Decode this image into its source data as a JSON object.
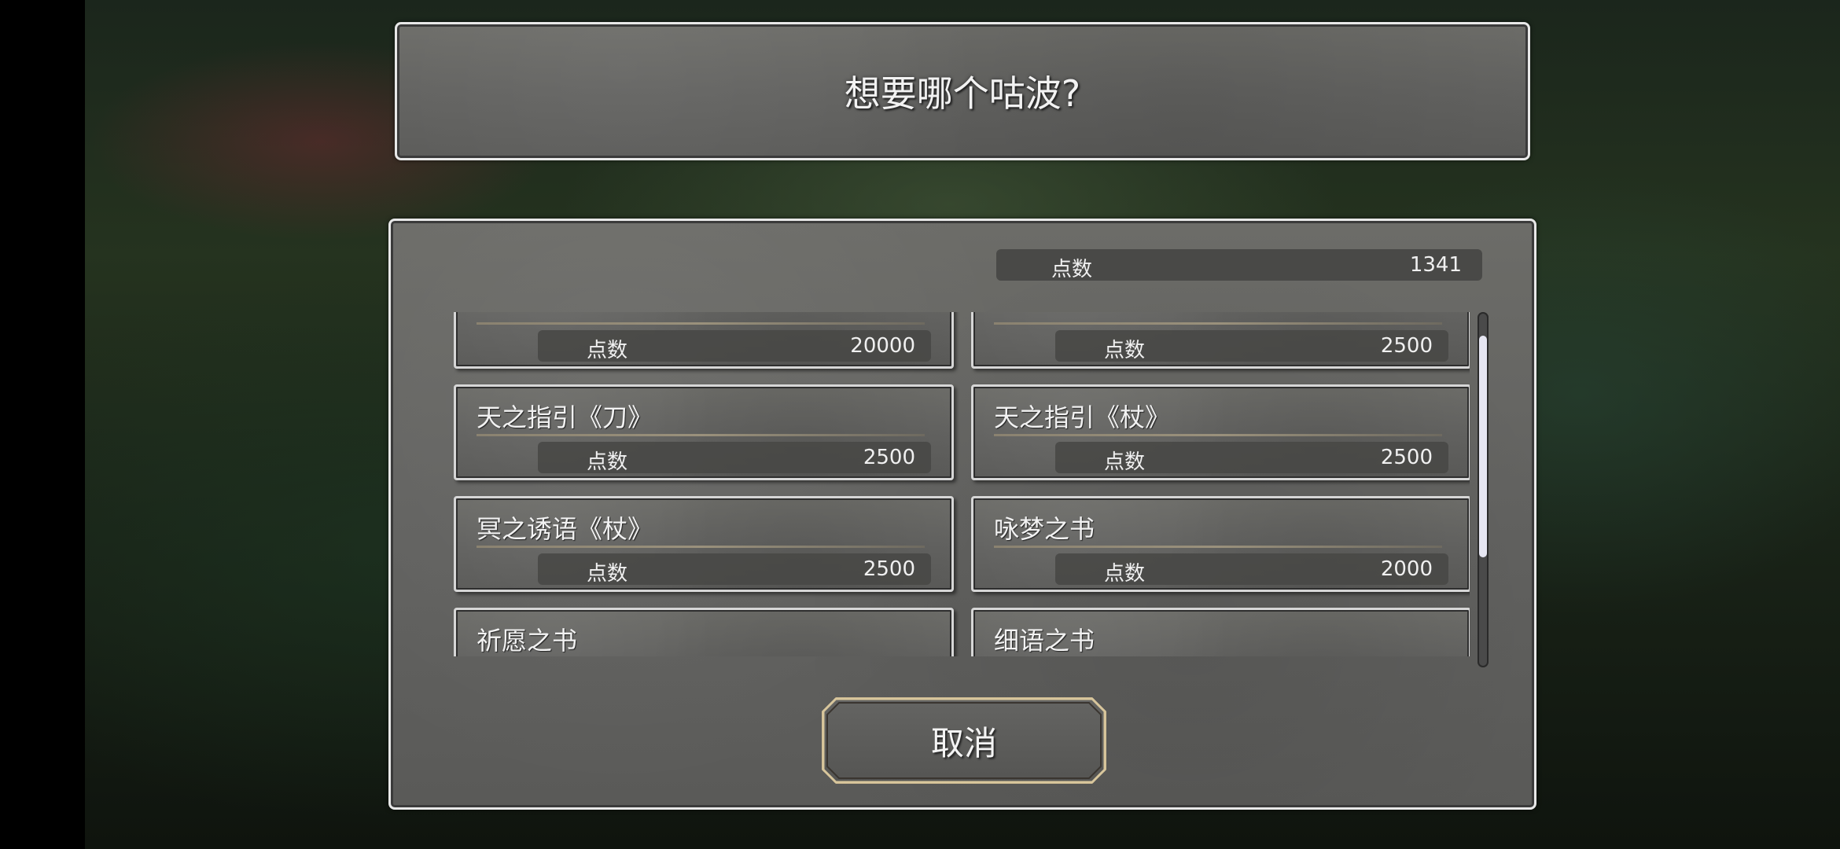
{
  "dialog": {
    "title": "想要哪个咕波?",
    "points_label": "点数",
    "points_value": "1341",
    "cancel_label": "取消"
  },
  "items": [
    {
      "name": "",
      "cost_label": "点数",
      "cost": "20000"
    },
    {
      "name": "",
      "cost_label": "点数",
      "cost": "2500"
    },
    {
      "name": "天之指引《刀》",
      "cost_label": "点数",
      "cost": "2500"
    },
    {
      "name": "天之指引《杖》",
      "cost_label": "点数",
      "cost": "2500"
    },
    {
      "name": "冥之诱语《杖》",
      "cost_label": "点数",
      "cost": "2500"
    },
    {
      "name": "咏梦之书",
      "cost_label": "点数",
      "cost": "2000"
    },
    {
      "name": "祈愿之书",
      "cost_label": "",
      "cost": ""
    },
    {
      "name": "细语之书",
      "cost_label": "",
      "cost": ""
    }
  ],
  "scrollbar": {
    "thumb_color": "#e6e6f2",
    "scroll_fraction": 0.1
  }
}
